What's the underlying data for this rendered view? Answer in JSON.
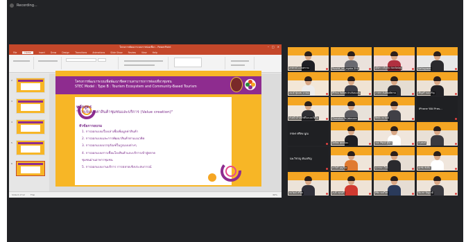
{
  "recording": {
    "label": "Recording..."
  },
  "ppt": {
    "title": "โครงการพัฒนาระบบการท่องเที่ยว - PowerPoint",
    "tabs": [
      "File",
      "Home",
      "Insert",
      "Draw",
      "Design",
      "Transitions",
      "Animations",
      "Slide Show",
      "Review",
      "View",
      "Help"
    ],
    "active_tab": "Home",
    "status_left": "Slide 6 of 12",
    "status_lang": "Thai",
    "zoom": "66%",
    "thumbs": [
      "2",
      "3",
      "4",
      "5",
      "6"
    ]
  },
  "slide": {
    "header_line1": "โครงการพัฒนาระบบเพื่อพัฒนาขีดความสามารถการท่องเที่ยวชุมชน",
    "header_line2": "STEC Model : Type B : Tourism Ecosystem and Community-Based Tourism",
    "course_label": "หลักสูตร",
    "course_title": "\"การเพิ่มมูลค่าสินค้าชุมชนและบริการ (Value creation)\"",
    "subheading": "หัวข้อการอบรม",
    "topics": [
      "1. การออกแบบเรื่องเล่าเพื่อเพิ่มมูลค่าสินค้า",
      "2. การออกแบบและการพัฒนาสินค้าตามแนวคิด",
      "3. การออกแบบบรรจุภัณฑ์ในรูปแบบต่างๆ",
      "4. การออกแบบการเชื่อมโยงสินค้าและบริการเข้าสู่ตลาด",
      "5. การออกแบบงานบริการ การตลาดเชิงประสบการณ์"
    ],
    "topics_wrap": "ชุมชนผ่านอาหารชุมชน"
  },
  "participants": [
    {
      "name": "อรพรรณ์ อ.ธนพรรณ",
      "style": "person",
      "bg": "#efe4d8",
      "shirt": "#1f1f24"
    },
    {
      "name": "Panchit_lek_myaka ZHU",
      "style": "person",
      "bg": "#eae2dc",
      "shirt": "#6a6a70"
    },
    {
      "name": "สุจิตรา ทวีภูมิรุ่ง จังหวัดปทุม",
      "style": "person",
      "bg": "#f2dcdc",
      "shirt": "#b03040"
    },
    {
      "name": "Nattagawat",
      "style": "person",
      "bg": "#e8e8e8",
      "shirt": "#2a2a2e"
    },
    {
      "name": "อนงค์ พุ่มแพง นาทอง",
      "style": "person",
      "bg": "#f3e7d7",
      "shirt": "#ededed"
    },
    {
      "name": "ศิริรัตน์ กิตติสุข ประจันตะเสน",
      "style": "person",
      "bg": "#f0e3d3",
      "shirt": "#3b3b44"
    },
    {
      "name": "ภาสกร ตันติพงศ์ธรรม",
      "style": "person",
      "bg": "#e5ddd2",
      "shirt": "#2e2e33"
    },
    {
      "name": "เพ็ญศรี ทองเจริญ",
      "style": "person",
      "bg": "#ece2d6",
      "shirt": "#222226"
    },
    {
      "name": "หัวหน้าเจ้าหน้าที่ในระบบวีดีโอ",
      "style": "person",
      "bg": "#efe6dc",
      "shirt": "#2f2f33"
    },
    {
      "name": "Chanokon Pe Jakosoon",
      "style": "person",
      "bg": "#e8e2da",
      "shirt": "#5b5b60"
    },
    {
      "name": "พิสมัย ธนวัฒน์",
      "style": "person",
      "bg": "#eee4da",
      "shirt": "#404046"
    },
    {
      "name": "iPhone ของ Pras...",
      "style": "blank"
    },
    {
      "name": "กชพร ศรีคง นูณ",
      "style": "blank"
    },
    {
      "name": "อิทธิพล พุทธนิยม",
      "style": "person",
      "bg": "#ede2d6",
      "shirt": "#1f1f24"
    },
    {
      "name": "กมล PNAB ฐิติกร",
      "style": "person",
      "bg": "#f0e6dc",
      "shirt": "#ffffff"
    },
    {
      "name": "ปรุงพงษ์",
      "style": "person",
      "bg": "#e9e0d6",
      "shirt": "#3a3a40"
    },
    {
      "name": "นพ.วิชาญ ตันเจริญ",
      "style": "blank"
    },
    {
      "name": "สาวิตรี บุญเรือง",
      "style": "person",
      "bg": "#efe5da",
      "shirt": "#e07a30"
    },
    {
      "name": "สุวรรณา ใจดี",
      "style": "person",
      "bg": "#e7ded4",
      "shirt": "#2a2a2e"
    },
    {
      "name": "ศุภชัย ทับทิม",
      "style": "person",
      "bg": "#f0e6dc",
      "shirt": "#ffffff"
    },
    {
      "name": "ธนวัฒน์ ศรีสุข",
      "style": "person",
      "bg": "#ece3d9",
      "shirt": "#30303a"
    },
    {
      "name": "อรุณี อรุณศรี",
      "style": "person",
      "bg": "#efe3d6",
      "shirt": "#d03a30"
    },
    {
      "name": "พิชิต พงษ์ไพร",
      "style": "person",
      "bg": "#e6ddd3",
      "shirt": "#2a3a5a"
    },
    {
      "name": "ปิยะพร ปัญญาดี",
      "style": "person",
      "bg": "#eee4d9",
      "shirt": "#3a3a40"
    }
  ]
}
